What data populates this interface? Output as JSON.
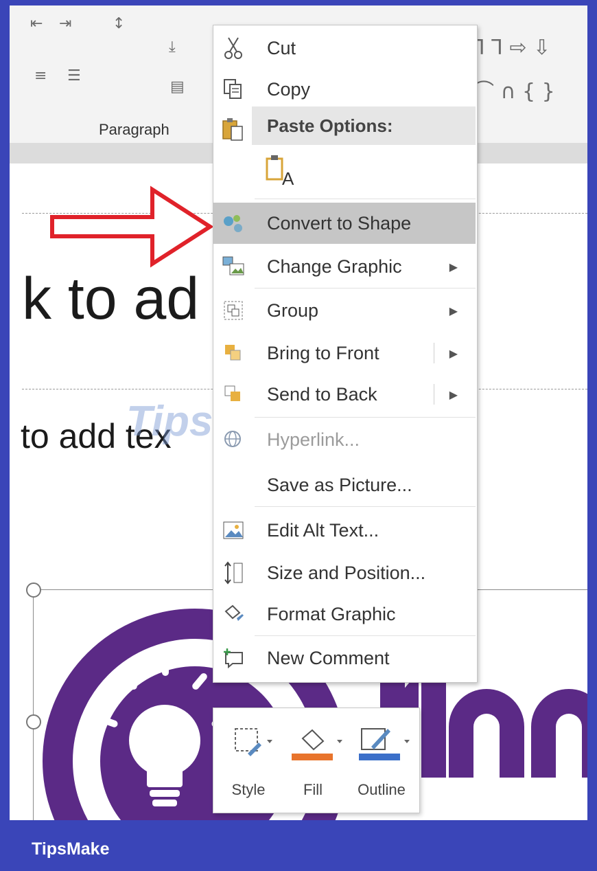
{
  "ribbon": {
    "group_label": "Paragraph"
  },
  "slide": {
    "title_text": "k to ad",
    "subtitle_text": "to add tex"
  },
  "context_menu": {
    "items": [
      {
        "id": "cut",
        "label": "Cut",
        "icon": "scissors-icon"
      },
      {
        "id": "copy",
        "label": "Copy",
        "icon": "copy-icon"
      },
      {
        "id": "paste-options",
        "label": "Paste Options:",
        "icon": "paste-icon"
      },
      {
        "id": "paste-text-only",
        "label": "A",
        "icon": "paste-keep-text-icon"
      },
      {
        "id": "convert-to-shape",
        "label": "Convert to Shape",
        "icon": "convert-shape-icon"
      },
      {
        "id": "change-graphic",
        "label": "Change Graphic",
        "icon": "change-graphic-icon",
        "submenu": true
      },
      {
        "id": "group",
        "label": "Group",
        "icon": "group-icon",
        "submenu": true
      },
      {
        "id": "bring-to-front",
        "label": "Bring to Front",
        "icon": "bring-front-icon",
        "submenu": true
      },
      {
        "id": "send-to-back",
        "label": "Send to Back",
        "icon": "send-back-icon",
        "submenu": true
      },
      {
        "id": "hyperlink",
        "label": "Hyperlink...",
        "icon": "globe-link-icon",
        "disabled": true
      },
      {
        "id": "save-as-picture",
        "label": "Save as Picture..."
      },
      {
        "id": "edit-alt-text",
        "label": "Edit Alt Text...",
        "icon": "alt-text-icon"
      },
      {
        "id": "size-and-position",
        "label": "Size and Position...",
        "icon": "size-position-icon"
      },
      {
        "id": "format-graphic",
        "label": "Format Graphic",
        "icon": "paint-bucket-icon"
      },
      {
        "id": "new-comment",
        "label": "New Comment",
        "icon": "comment-icon"
      }
    ]
  },
  "mini_toolbar": {
    "style_label": "Style",
    "fill_label": "Fill",
    "outline_label": "Outline",
    "fill_color": "#e8742c",
    "outline_color": "#3b6fc9"
  },
  "watermark": {
    "text": "TipsMake"
  },
  "footer": {
    "brand": "TipsMake"
  },
  "colors": {
    "frame_border": "#3a45b8",
    "logo_purple": "#5b2a86",
    "arrow_red": "#e0222a",
    "highlight": "#c6c6c6"
  }
}
